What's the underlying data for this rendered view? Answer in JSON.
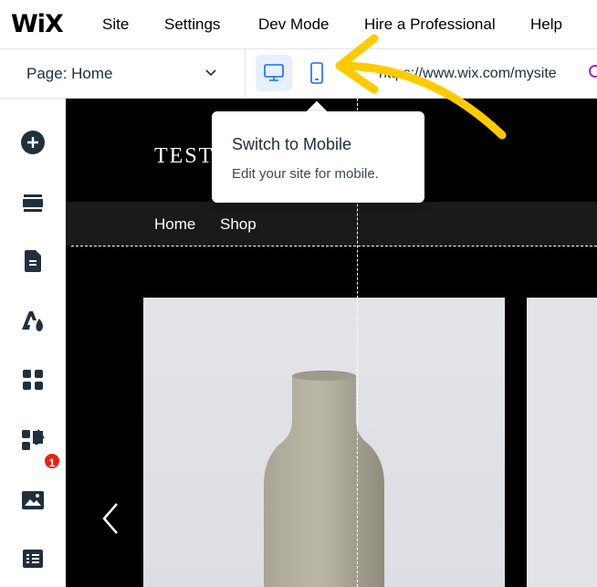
{
  "app": {
    "logo": "WiX"
  },
  "top_menu": [
    {
      "label": "Site"
    },
    {
      "label": "Settings"
    },
    {
      "label": "Dev Mode"
    },
    {
      "label": "Hire a Professional"
    },
    {
      "label": "Help"
    }
  ],
  "page_selector": {
    "label": "Page: Home"
  },
  "address": {
    "url": "https://www.wix.com/mysite"
  },
  "tooltip": {
    "title": "Switch to Mobile",
    "body": "Edit your site for mobile."
  },
  "site": {
    "title": "TESTS",
    "nav": [
      "Home",
      "Shop"
    ]
  },
  "left_tools": {
    "icons": [
      "add-icon",
      "sections-icon",
      "pages-icon",
      "design-icon",
      "apps-icon",
      "business-icon",
      "media-icon",
      "cms-icon"
    ],
    "apps_badge": "1"
  },
  "colors": {
    "accent": "#116dff",
    "active_bg": "#e7f0ff",
    "badge": "#e62214",
    "annotation": "#ffcb00"
  }
}
